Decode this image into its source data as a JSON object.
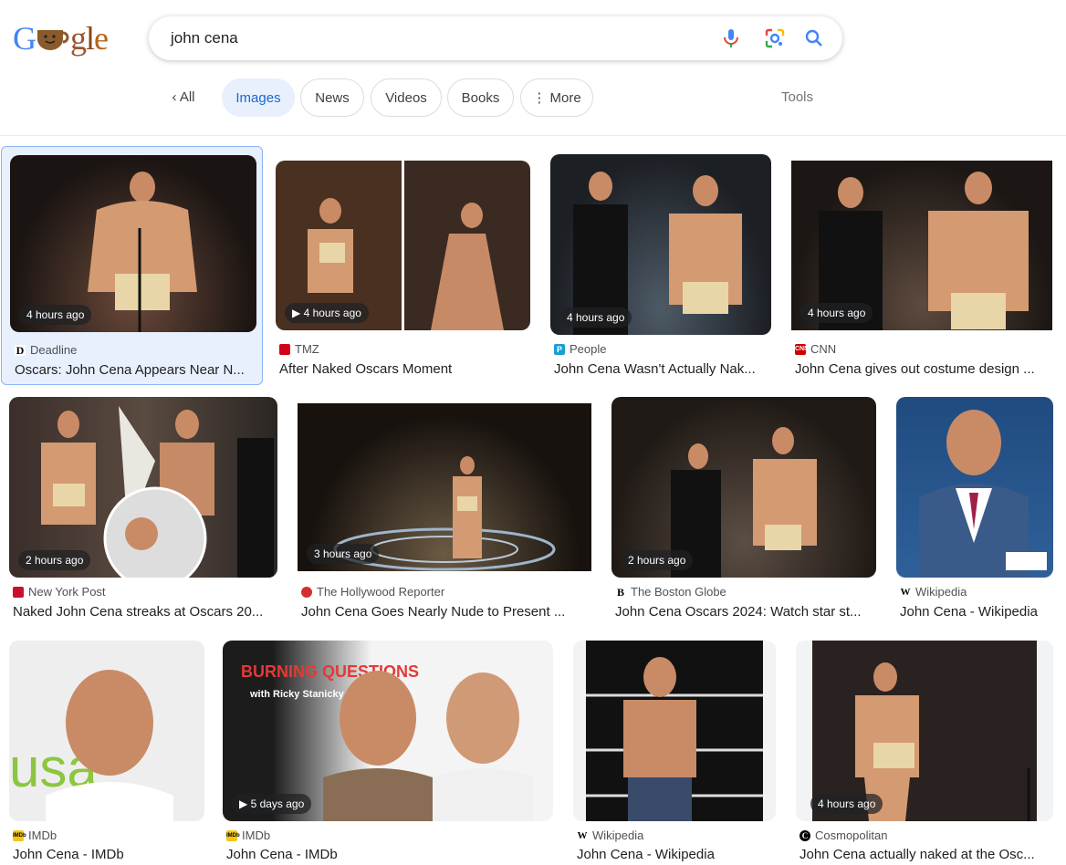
{
  "logo": {
    "text": "Google"
  },
  "search": {
    "query": "john cena"
  },
  "tabs": [
    {
      "label": "All"
    },
    {
      "label": "Images"
    },
    {
      "label": "News"
    },
    {
      "label": "Videos"
    },
    {
      "label": "Books"
    },
    {
      "label": "More"
    }
  ],
  "tools_label": "Tools",
  "colors": {
    "accent": "#1967d2",
    "selected_bg": "#e8f0fe",
    "stage_gold": "#c9a56a",
    "skin": "#d49a72"
  },
  "results": [
    {
      "time": "4 hours ago",
      "source": "Deadline",
      "title": "Oscars: John Cena Appears Near N..."
    },
    {
      "time": "4 hours ago",
      "source": "TMZ",
      "title": "After Naked Oscars Moment"
    },
    {
      "time": "4 hours ago",
      "source": "People",
      "title": "John Cena Wasn't Actually Nak..."
    },
    {
      "time": "4 hours ago",
      "source": "CNN",
      "title": "John Cena gives out costume design ..."
    },
    {
      "time": "2 hours ago",
      "source": "New York Post",
      "title": "Naked John Cena streaks at Oscars 20..."
    },
    {
      "time": "3 hours ago",
      "source": "The Hollywood Reporter",
      "title": "John Cena Goes Nearly Nude to Present ..."
    },
    {
      "time": "2 hours ago",
      "source": "The Boston Globe",
      "title": "John Cena Oscars 2024: Watch star st..."
    },
    {
      "time": "",
      "source": "Wikipedia",
      "title": "John Cena - Wikipedia"
    },
    {
      "time": "",
      "source": "IMDb",
      "title": "John Cena - IMDb"
    },
    {
      "time": "5 days ago",
      "source": "IMDb",
      "title": "John Cena - IMDb"
    },
    {
      "time": "",
      "source": "Wikipedia",
      "title": "John Cena - Wikipedia"
    },
    {
      "time": "4 hours ago",
      "source": "Cosmopolitan",
      "title": "John Cena actually naked at the Osc..."
    }
  ],
  "thumb_texts": {
    "burning_questions": "BURNING QUESTIONS",
    "ricky": "with Ricky Stanicky",
    "usa": "usa"
  }
}
